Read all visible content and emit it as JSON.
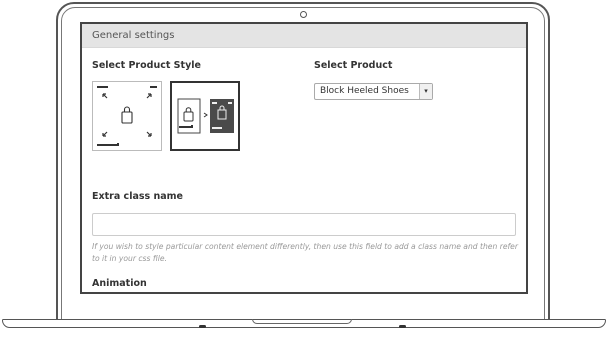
{
  "panel": {
    "title": "General settings"
  },
  "product_style": {
    "label": "Select Product Style",
    "options": [
      "style-centered-icon",
      "style-image-preview"
    ],
    "selected_index": 1
  },
  "select_product": {
    "label": "Select Product",
    "value": "Block Heeled Shoes",
    "arrow": "▾"
  },
  "extra_class": {
    "label": "Extra class name",
    "value": "",
    "help": "If you wish to style particular content element differently, then use this field to add a class name and then refer to it in your css file."
  },
  "animation": {
    "label": "Animation"
  },
  "icons": {
    "camera": "camera-icon",
    "bag": "shopping-bag-icon",
    "arrows": "expand-arrows-icon"
  }
}
